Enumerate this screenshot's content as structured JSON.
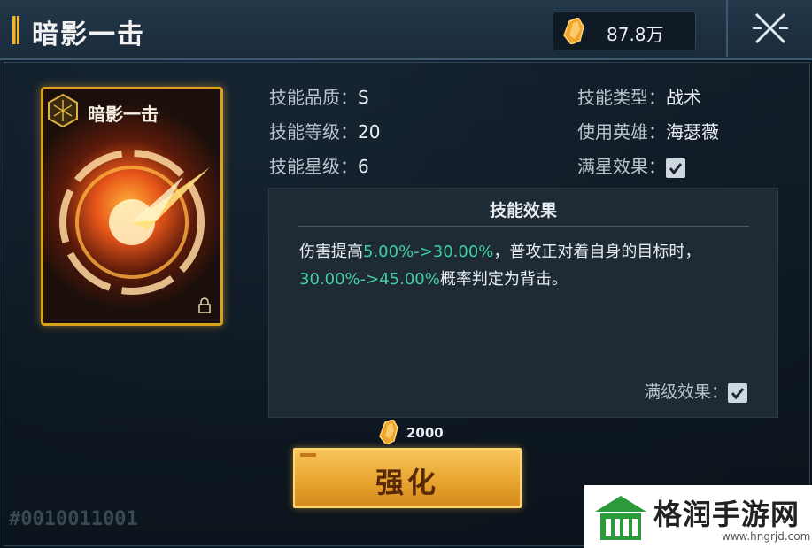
{
  "header": {
    "title": "暗影一击",
    "currency_value": "87.8万",
    "currency_icon": "crystal-icon",
    "close_icon": "close-icon"
  },
  "card": {
    "name": "暗影一击",
    "emblem_icon": "hexagon-emblem-icon",
    "lock_icon": "lock-icon"
  },
  "attributes": {
    "quality_label": "技能品质：",
    "quality_value": "S",
    "level_label": "技能等级：",
    "level_value": "20",
    "star_label": "技能星级：",
    "star_value": "6",
    "type_label": "技能类型：",
    "type_value": "战术",
    "hero_label": "使用英雄：",
    "hero_value": "海瑟薇",
    "full_star_label": "满星效果：",
    "full_star_checked": true
  },
  "effect": {
    "title": "技能效果",
    "text_1": "伤害提高",
    "highlight_1": "5.00%->30.00%",
    "text_2": "，普攻正对着自身的目标时，",
    "highlight_2": "30.00%->45.00%",
    "text_3": "概率判定为背击。",
    "max_level_label": "满级效果：",
    "max_level_checked": true
  },
  "upgrade": {
    "cost": "2000",
    "button_label": "强化"
  },
  "footer": {
    "code": "#0010011001"
  },
  "watermark": {
    "name": "格润手游网",
    "url": "www.hngrjd.com"
  },
  "colors": {
    "accent_gold": "#f7b52a",
    "highlight_green": "#3fcfa0",
    "panel_bg": "#1e2a34"
  }
}
